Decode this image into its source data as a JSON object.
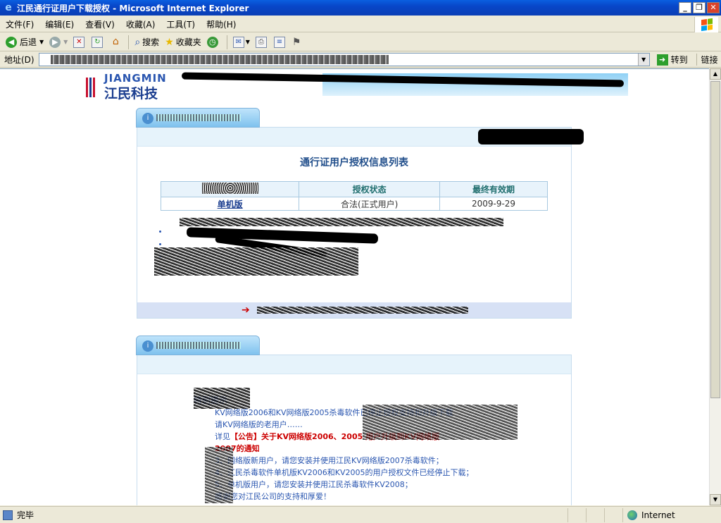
{
  "window": {
    "title": "江民通行证用户下载授权 - Microsoft Internet Explorer",
    "controls": {
      "minimize": "_",
      "restore": "❐",
      "close": "✕"
    }
  },
  "menubar": {
    "items": [
      "文件(F)",
      "编辑(E)",
      "查看(V)",
      "收藏(A)",
      "工具(T)",
      "帮助(H)"
    ]
  },
  "toolbar": {
    "back_label": "后退",
    "search_label": "搜索",
    "favorites_label": "收藏夹"
  },
  "addressbar": {
    "label": "地址(D)",
    "go_label": "转到",
    "links_label": "链接"
  },
  "banner": {
    "brand_en": "JIANGMIN",
    "brand_cn": "江民科技"
  },
  "auth_panel": {
    "list_title": "通行证用户授权信息列表",
    "table": {
      "headers": [
        "",
        "授权状态",
        "最终有效期"
      ],
      "rows": [
        {
          "product": "单机版",
          "status": "合法(正式用户)",
          "expiry": "2009-9-29"
        }
      ]
    }
  },
  "notice_panel": {
    "heading": "特别提示",
    "lines": [
      "KV网络版2006和KV网络版2005杀毒软件已停止授权支持和升级下载",
      "请KV网络版的老用户……",
      "详见",
      "【公告】关于KV网络版2006、2005 用户升级到KV网络版",
      "2007的通知",
      "3、网络版新用户，请您安装并使用江民KV网络版2007杀毒软件；",
      "4、江民杀毒软件单机版KV2006和KV2005的用户授权文件已经停止下载；",
      "5、单机版用户，请您安装并使用江民杀毒软件KV2008；",
      "感谢您对江民公司的支持和厚爱！"
    ]
  },
  "statusbar": {
    "status_text": "完毕",
    "zone_text": "Internet"
  },
  "colors": {
    "titlebar": "#0a46c8",
    "link_blue": "#1a3d8f",
    "alert_red": "#cc0000",
    "panel_blue": "#e6f3fb"
  }
}
